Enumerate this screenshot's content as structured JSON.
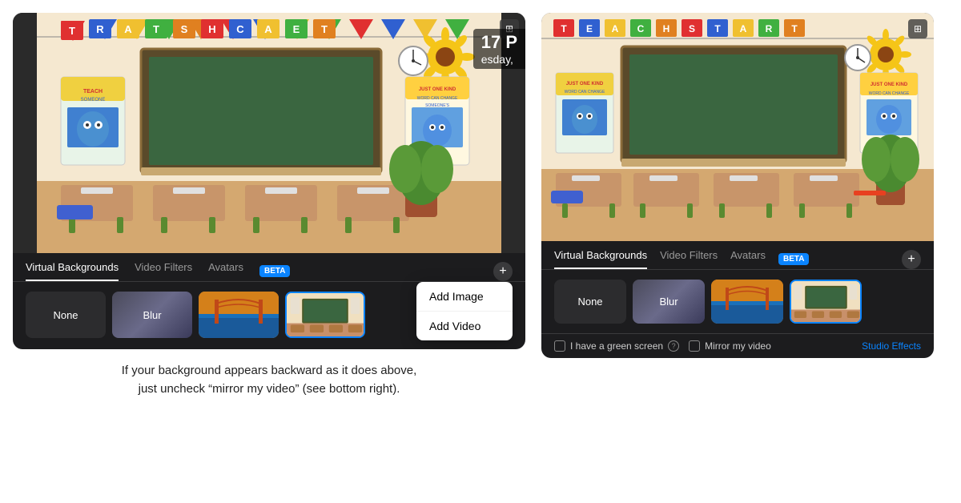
{
  "left_panel": {
    "tabs": [
      {
        "label": "Virtual Backgrounds",
        "active": true
      },
      {
        "label": "Video Filters",
        "active": false
      },
      {
        "label": "Avatars",
        "active": false
      }
    ],
    "beta_label": "BETA",
    "bg_options": [
      {
        "id": "none",
        "label": "None"
      },
      {
        "id": "blur",
        "label": "Blur"
      },
      {
        "id": "bridge",
        "label": ""
      },
      {
        "id": "classroom",
        "label": ""
      }
    ],
    "dropdown": {
      "items": [
        "Add Image",
        "Add Video"
      ]
    },
    "timestamp": "17 P",
    "timestamp2": "esday,"
  },
  "right_panel": {
    "tabs": [
      {
        "label": "Virtual Backgrounds",
        "active": true
      },
      {
        "label": "Video Filters",
        "active": false
      },
      {
        "label": "Avatars",
        "active": false
      }
    ],
    "beta_label": "BETA",
    "bg_options": [
      {
        "id": "none",
        "label": "None"
      },
      {
        "id": "blur",
        "label": "Blur"
      },
      {
        "id": "bridge",
        "label": ""
      },
      {
        "id": "classroom",
        "label": ""
      }
    ],
    "bottom_bar": {
      "green_screen_label": "I have a green screen",
      "mirror_label": "Mirror my video",
      "studio_effects_label": "Studio Effects"
    }
  },
  "caption": {
    "line1": "If your background appears backward as it does above,",
    "line2": "just uncheck “mirror my video” (see bottom right)."
  }
}
